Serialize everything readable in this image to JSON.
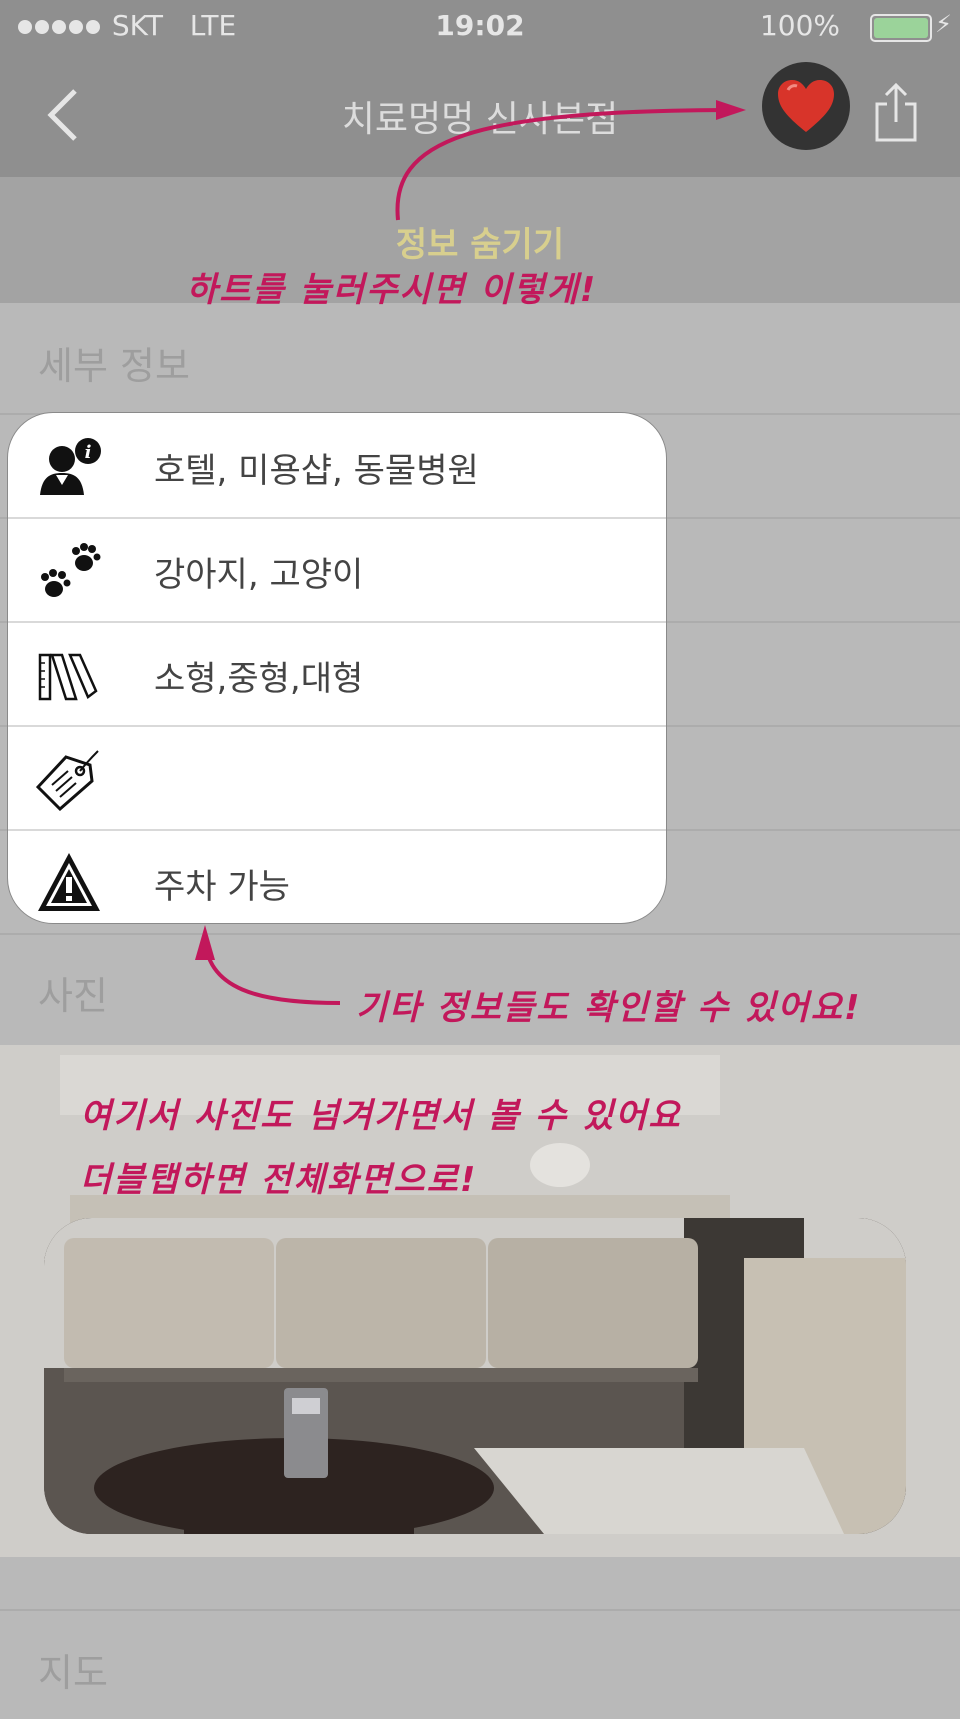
{
  "status": {
    "carrier": "SKT",
    "network": "LTE",
    "time": "19:02",
    "battery": "100%"
  },
  "nav": {
    "title": "치료멍멍 신사본점"
  },
  "hide_label": "정보 숨기기",
  "sections": {
    "detail": "세부 정보",
    "photo": "사진",
    "map": "지도"
  },
  "info_rows": [
    {
      "icon": "person-info-icon",
      "text": "호텔, 미용샵, 동물병원"
    },
    {
      "icon": "paw-prints-icon",
      "text": "강아지, 고양이"
    },
    {
      "icon": "ruler-size-icon",
      "text": "소형,중형,대형"
    },
    {
      "icon": "price-tag-icon",
      "text": ""
    },
    {
      "icon": "warning-icon",
      "text": "주차 가능"
    }
  ],
  "annotations": {
    "heart": "하트를 눌러주시면 이렇게!",
    "info": "기타 정보들도 확인할 수 있어요!",
    "photo_line1": "여기서 사진도 넘겨가면서 볼 수 있어요",
    "photo_line2": "더블탭하면 전체화면으로!"
  },
  "colors": {
    "annotation": "#c2185b",
    "heart": "#d8342a",
    "hide_label": "#d8cf8e"
  }
}
